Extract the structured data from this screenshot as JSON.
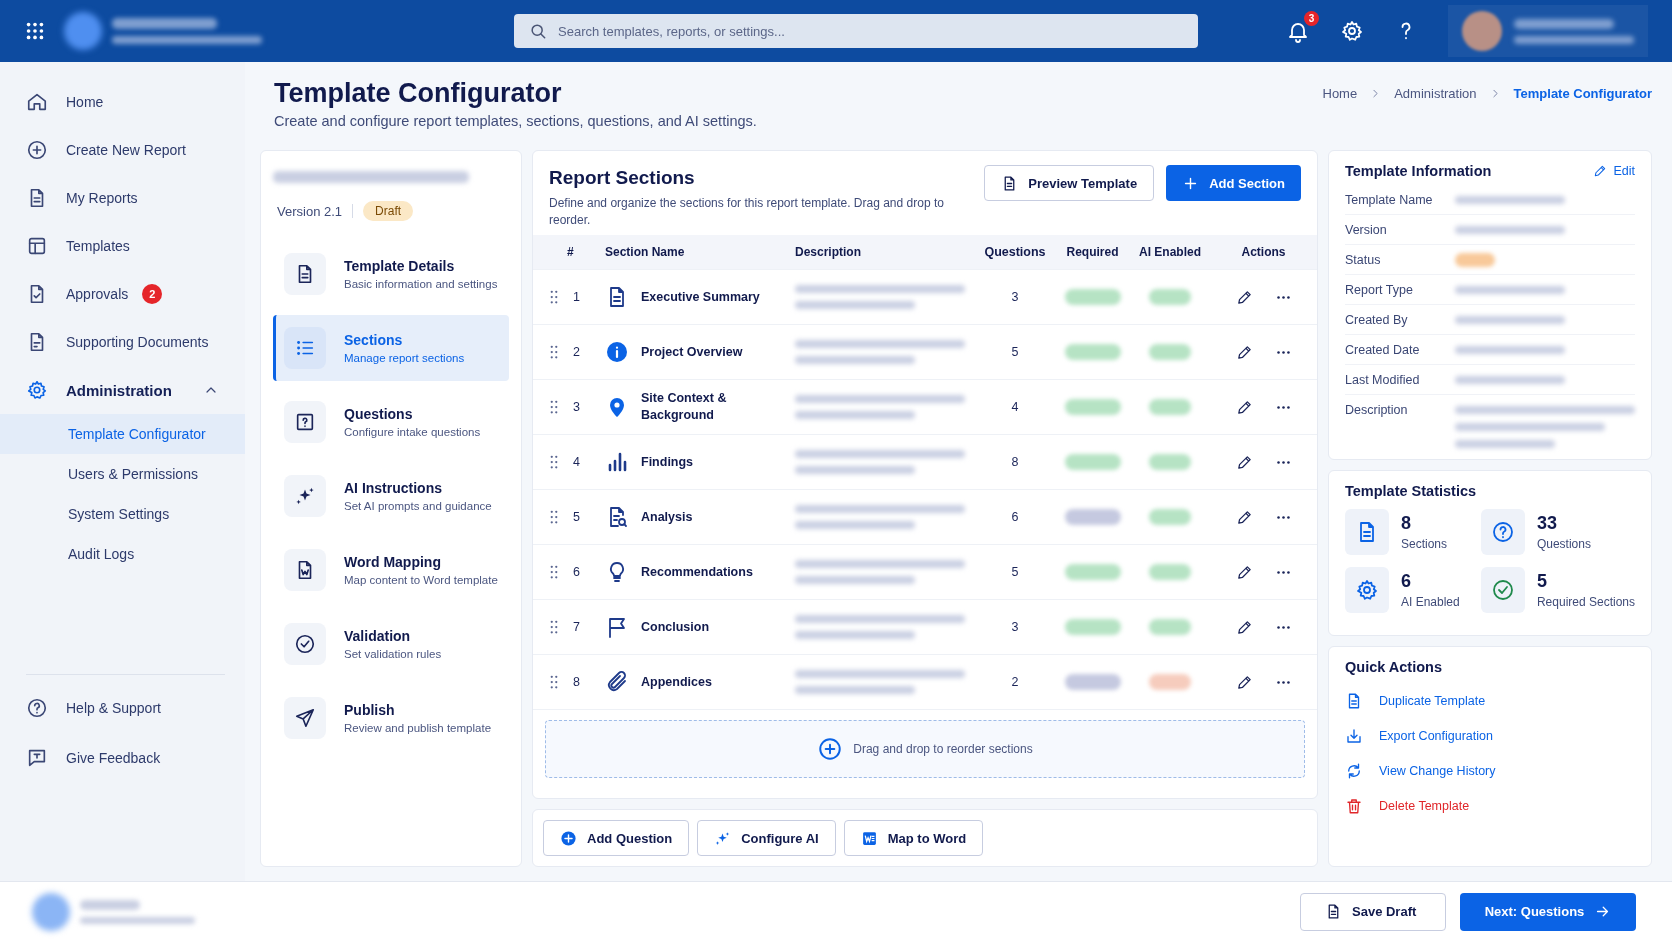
{
  "header": {
    "search": {
      "placeholder": "Search templates, reports, or settings..."
    },
    "notification_count": "3"
  },
  "sidebar": {
    "items": [
      {
        "label": "Home",
        "kind": "home",
        "selected": false
      },
      {
        "label": "Create New Report",
        "kind": "create",
        "selected": false
      },
      {
        "label": "My Reports",
        "kind": "reports",
        "selected": false
      },
      {
        "label": "Templates",
        "kind": "templates",
        "selected": false
      },
      {
        "label": "Approvals",
        "kind": "approvals",
        "selected": false,
        "badge": "2"
      },
      {
        "label": "Supporting Documents",
        "kind": "documents",
        "selected": false
      },
      {
        "label": "Administration",
        "kind": "admin",
        "selected": false,
        "expanded": true,
        "children": [
          {
            "label": "Template Configurator",
            "selected": true
          },
          {
            "label": "Users & Permissions",
            "selected": false
          },
          {
            "label": "System Settings",
            "selected": false
          },
          {
            "label": "Audit Logs",
            "selected": false
          }
        ]
      }
    ],
    "footer_items": [
      {
        "label": "Help & Support",
        "kind": "help",
        "selected": false
      },
      {
        "label": "Give Feedback",
        "kind": "feedback",
        "selected": false
      }
    ]
  },
  "page": {
    "title": "Template Configurator",
    "subtitle": "Create and configure report templates, sections, questions, and AI settings.",
    "breadcrumb": [
      {
        "label": "Home",
        "selected": false
      },
      {
        "label": "Administration",
        "selected": false
      },
      {
        "label": "Template Configurator",
        "selected": true
      }
    ]
  },
  "template_card": {
    "version": "Version 2.1",
    "status": "Draft",
    "steps": [
      {
        "title": "Template Details",
        "subtitle": "Basic information and settings",
        "kind": "details",
        "selected": false
      },
      {
        "title": "Sections",
        "subtitle": "Manage report sections",
        "kind": "sections",
        "selected": true
      },
      {
        "title": "Questions",
        "subtitle": "Configure intake questions",
        "kind": "questions",
        "selected": false
      },
      {
        "title": "AI Instructions",
        "subtitle": "Set AI prompts and guidance",
        "kind": "ai",
        "selected": false
      },
      {
        "title": "Word Mapping",
        "subtitle": "Map content to Word template",
        "kind": "word",
        "selected": false
      },
      {
        "title": "Validation",
        "subtitle": "Set validation rules",
        "kind": "validation",
        "selected": false
      },
      {
        "title": "Publish",
        "subtitle": "Review and publish template",
        "kind": "publish",
        "selected": false
      }
    ]
  },
  "sections": {
    "title": "Report Sections",
    "description": "Define and organize the sections for this report template. Drag and drop to reorder.",
    "preview_button": "Preview Template",
    "add_button": "Add Section",
    "columns": [
      "#",
      "Section Name",
      "Description",
      "Questions",
      "Required",
      "AI Enabled",
      "Actions"
    ],
    "rows": [
      {
        "number": "1",
        "name": "Executive Summary",
        "kind": "summary",
        "questions": "3",
        "required": true,
        "ai_enabled": true
      },
      {
        "number": "2",
        "name": "Project Overview",
        "kind": "overview",
        "questions": "5",
        "required": true,
        "ai_enabled": true
      },
      {
        "number": "3",
        "name": "Site Context & Background",
        "kind": "site",
        "questions": "4",
        "required": true,
        "ai_enabled": true
      },
      {
        "number": "4",
        "name": "Findings",
        "kind": "findings",
        "questions": "8",
        "required": true,
        "ai_enabled": true
      },
      {
        "number": "5",
        "name": "Analysis",
        "kind": "analysis",
        "questions": "6",
        "required": false,
        "ai_enabled": true
      },
      {
        "number": "6",
        "name": "Recommendations",
        "kind": "recommendations",
        "questions": "5",
        "required": true,
        "ai_enabled": true
      },
      {
        "number": "7",
        "name": "Conclusion",
        "kind": "conclusion",
        "questions": "3",
        "required": true,
        "ai_enabled": true
      },
      {
        "number": "8",
        "name": "Appendices",
        "kind": "appendices",
        "questions": "2",
        "required": false,
        "ai_enabled": false
      }
    ],
    "drop_zone": "Drag and drop to reorder sections",
    "actions": [
      {
        "label": "Add Question",
        "kind": "question"
      },
      {
        "label": "Configure AI",
        "kind": "ai"
      },
      {
        "label": "Map to Word",
        "kind": "word"
      }
    ]
  },
  "info": {
    "title": "Template Information",
    "edit": "Edit",
    "fields": [
      {
        "label": "Template Name",
        "kind": "text"
      },
      {
        "label": "Version",
        "kind": "text"
      },
      {
        "label": "Status",
        "kind": "badge"
      },
      {
        "label": "Report Type",
        "kind": "text"
      },
      {
        "label": "Created By",
        "kind": "text"
      },
      {
        "label": "Created Date",
        "kind": "text"
      },
      {
        "label": "Last Modified",
        "kind": "text"
      },
      {
        "label": "Description",
        "kind": "paragraph"
      }
    ]
  },
  "statistics": {
    "title": "Template Statistics",
    "items": [
      {
        "value": "8",
        "label": "Sections",
        "kind": "sections",
        "color": "#0b63e5"
      },
      {
        "value": "33",
        "label": "Questions",
        "kind": "questions",
        "color": "#0b63e5"
      },
      {
        "value": "6",
        "label": "AI Enabled",
        "kind": "ai",
        "color": "#0b63e5"
      },
      {
        "value": "5",
        "label": "Required Sections",
        "kind": "required",
        "color": "#1f8a4c"
      }
    ]
  },
  "quick_actions": {
    "title": "Quick Actions",
    "items": [
      {
        "label": "Duplicate Template",
        "kind": "duplicate"
      },
      {
        "label": "Export Configuration",
        "kind": "export"
      },
      {
        "label": "View Change History",
        "kind": "history"
      },
      {
        "label": "Delete Template",
        "kind": "delete"
      }
    ]
  },
  "footer": {
    "save_button": "Save Draft",
    "next_button": "Next: Questions"
  }
}
